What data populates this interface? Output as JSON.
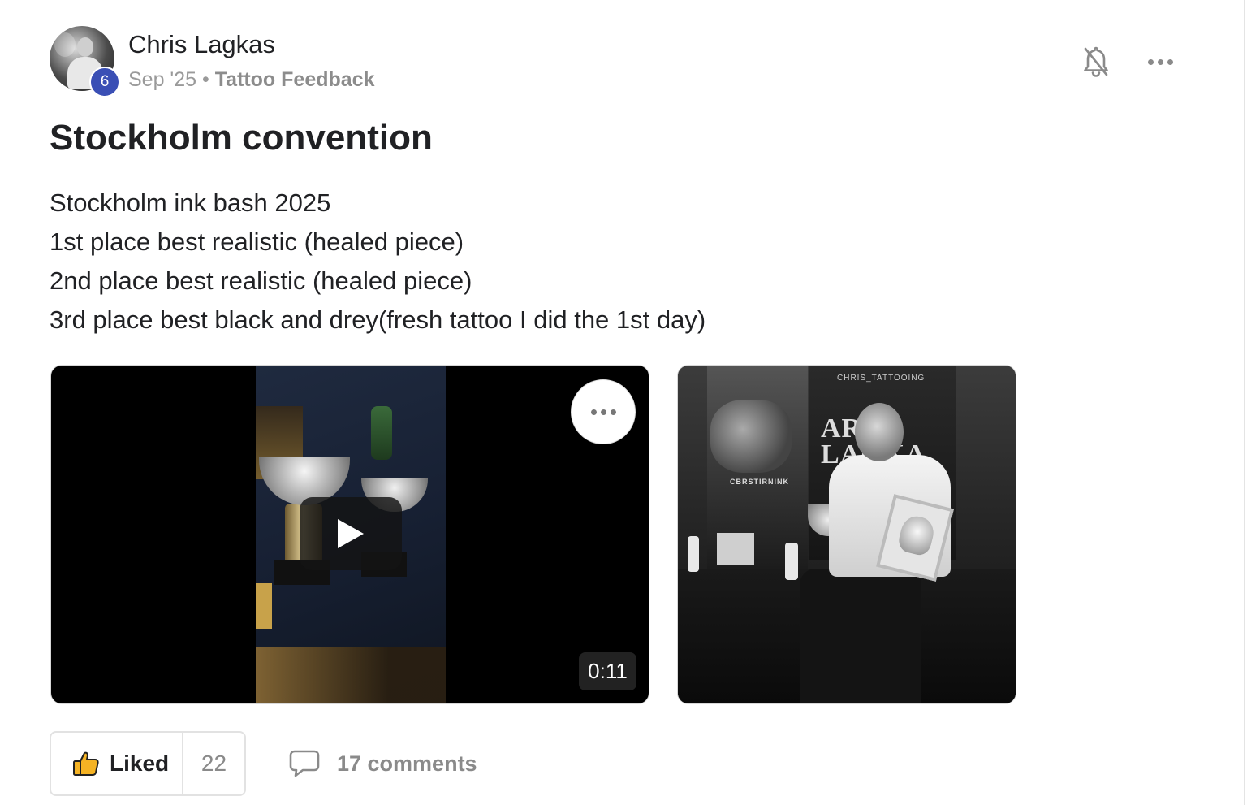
{
  "post": {
    "author": {
      "name": "Chris Lagkas",
      "level": "6"
    },
    "meta": {
      "date": "Sep '25",
      "separator": "•",
      "category": "Tattoo Feedback"
    },
    "title": "Stockholm convention",
    "body_lines": [
      "Stockholm ink bash 2025",
      "1st place best realistic (healed piece)",
      "2nd place best realistic (healed piece)",
      "3rd place best black and drey(fresh tattoo I did the 1st day)"
    ],
    "media": {
      "video": {
        "duration": "0:11"
      },
      "photo": {
        "banner_text_line1": "ARI",
        "banner_text_line2": "LAGKA",
        "insta_handle": "CHRIS_TATTOOING",
        "brand_text": "CBRSTIRNINK"
      }
    },
    "actions": {
      "like_label": "Liked",
      "like_count": "22",
      "comments_label": "17 comments"
    },
    "icons": {
      "bell": "bell-off-icon",
      "more": "more-horizontal-icon",
      "thumb": "thumbs-up-icon",
      "comment": "comment-icon",
      "play": "play-icon"
    },
    "colors": {
      "level_badge": "#3a4fb5",
      "like_icon_fill": "#f5b324",
      "muted_text": "#8a8a8a"
    }
  }
}
